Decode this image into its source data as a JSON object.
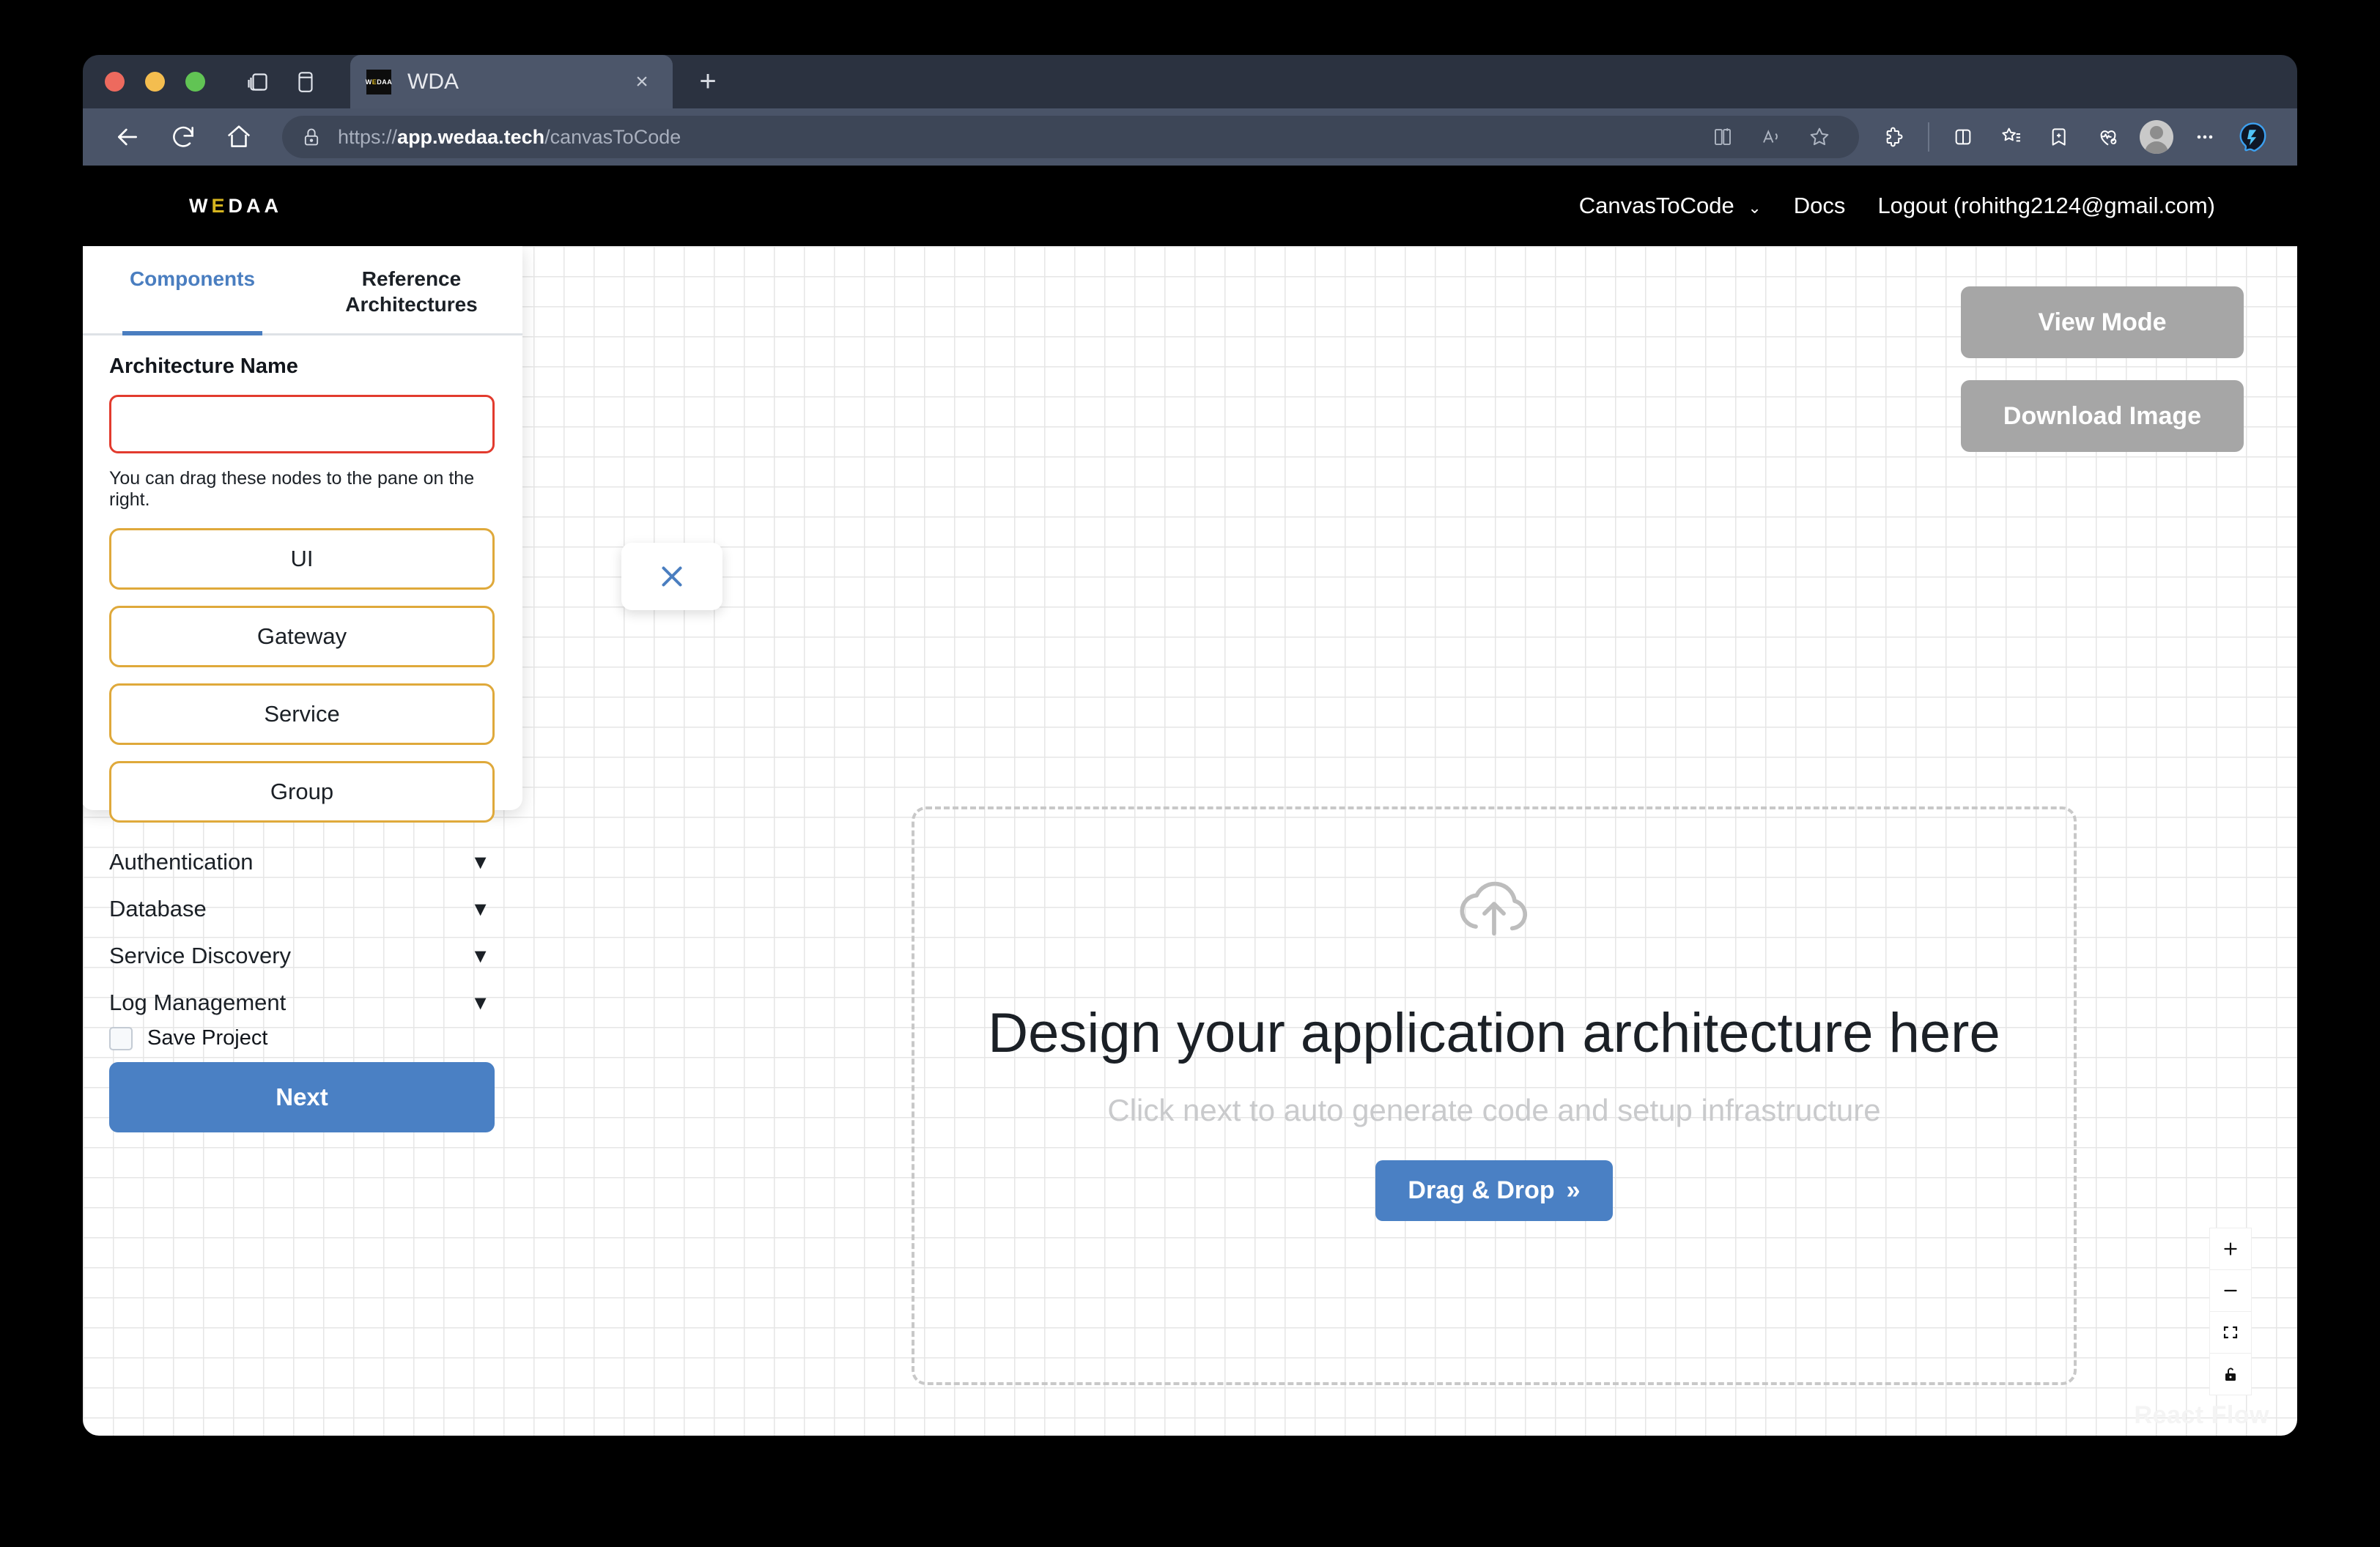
{
  "browser": {
    "tab": {
      "title": "WDA",
      "favicon_label": "WEDAA",
      "close_label": "×"
    },
    "new_tab_label": "+",
    "url": {
      "scheme": "https://",
      "host": "app.wedaa.tech",
      "path": "/canvasToCode"
    },
    "icons": {
      "back": "back-arrow-icon",
      "reload": "reload-icon",
      "home": "home-icon",
      "lock": "lock-icon",
      "split_screen": "split-screen-icon",
      "read_aloud": "read-aloud-icon",
      "favorite": "star-icon",
      "extensions": "extensions-icon",
      "browser_essentials": "browser-essentials-icon",
      "collections": "collections-icon",
      "add_to_favorites": "add-to-favorites-icon",
      "health": "health-icon",
      "profile": "profile-avatar-icon",
      "settings_more": "more-options-icon",
      "copilot": "copilot-icon"
    }
  },
  "app_header": {
    "logo": {
      "before_e": "W",
      "e": "E",
      "after_e": "DAA"
    },
    "nav": [
      {
        "label": "CanvasToCode",
        "caret": "⌄"
      },
      {
        "label": "Docs"
      },
      {
        "label": "Logout (rohithg2124@gmail.com)"
      }
    ]
  },
  "left_panel": {
    "tabs": [
      {
        "label": "Components",
        "active": true
      },
      {
        "label": "Reference Architectures",
        "active": false
      }
    ],
    "architecture_name": {
      "label": "Architecture Name",
      "value": "",
      "placeholder": ""
    },
    "drag_hint": "You can drag these nodes to the pane on the right.",
    "nodes": [
      {
        "label": "UI"
      },
      {
        "label": "Gateway"
      },
      {
        "label": "Service"
      },
      {
        "label": "Group"
      }
    ],
    "accordions": [
      {
        "label": "Authentication",
        "caret": "▼"
      },
      {
        "label": "Database",
        "caret": "▼"
      },
      {
        "label": "Service Discovery",
        "caret": "▼"
      },
      {
        "label": "Log Management",
        "caret": "▼"
      }
    ],
    "save_project": {
      "label": "Save Project",
      "checked": false
    },
    "next_button": "Next",
    "close_button": "close-icon"
  },
  "canvas": {
    "top_actions": [
      {
        "label": "View Mode"
      },
      {
        "label": "Download Image"
      }
    ],
    "empty_state": {
      "icon": "cloud-upload-icon",
      "title": "Design your application architecture here",
      "subtitle": "Click next to auto generate code and setup infrastructure",
      "button_label": "Drag & Drop",
      "button_chevrons": "»"
    },
    "watermark": "React Flow",
    "zoom_controls": [
      {
        "name": "zoom-in",
        "glyph": "+"
      },
      {
        "name": "zoom-out",
        "glyph": "−"
      },
      {
        "name": "fit-view",
        "glyph": "fit"
      },
      {
        "name": "toggle-interactivity",
        "glyph": "unlock"
      }
    ]
  },
  "colors": {
    "accent_blue": "#4a80c4",
    "node_border_gold": "#dfa93b",
    "input_error_red": "#e23b2e",
    "logo_gold": "#d6b51f",
    "action_gray": "#a6a6a6"
  }
}
